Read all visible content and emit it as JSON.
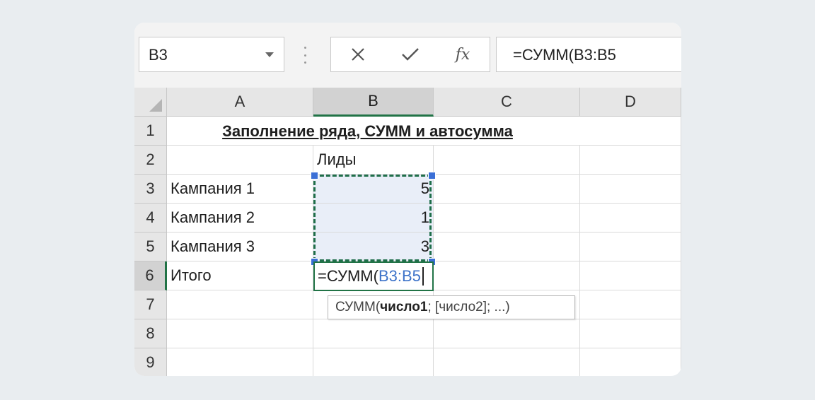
{
  "name_box": {
    "value": "B3"
  },
  "formula_bar": {
    "cancel_icon": "close-icon",
    "enter_icon": "check-icon",
    "fx_label": "fx",
    "value": "=СУММ(B3:B5"
  },
  "columns": [
    "A",
    "B",
    "C",
    "D"
  ],
  "active_column": "B",
  "rows": [
    "1",
    "2",
    "3",
    "4",
    "5",
    "6",
    "7",
    "8",
    "9"
  ],
  "active_row": "6",
  "cells": {
    "title": "Заполнение ряда, СУММ и автосумма",
    "b2": "Лиды",
    "a3": "Кампания 1",
    "b3": "5",
    "a4": "Кампания 2",
    "b4": "1",
    "a5": "Кампания 3",
    "b5": "3",
    "a6": "Итого"
  },
  "edit_cell": {
    "prefix": "=СУММ(",
    "ref": "B3:B5"
  },
  "tooltip": {
    "func": "СУММ(",
    "bold_arg": "число1",
    "rest": "; [число2]; ...)"
  },
  "colors": {
    "accent": "#217346",
    "ref": "#3d73c9",
    "selection": "#e9eef8"
  }
}
